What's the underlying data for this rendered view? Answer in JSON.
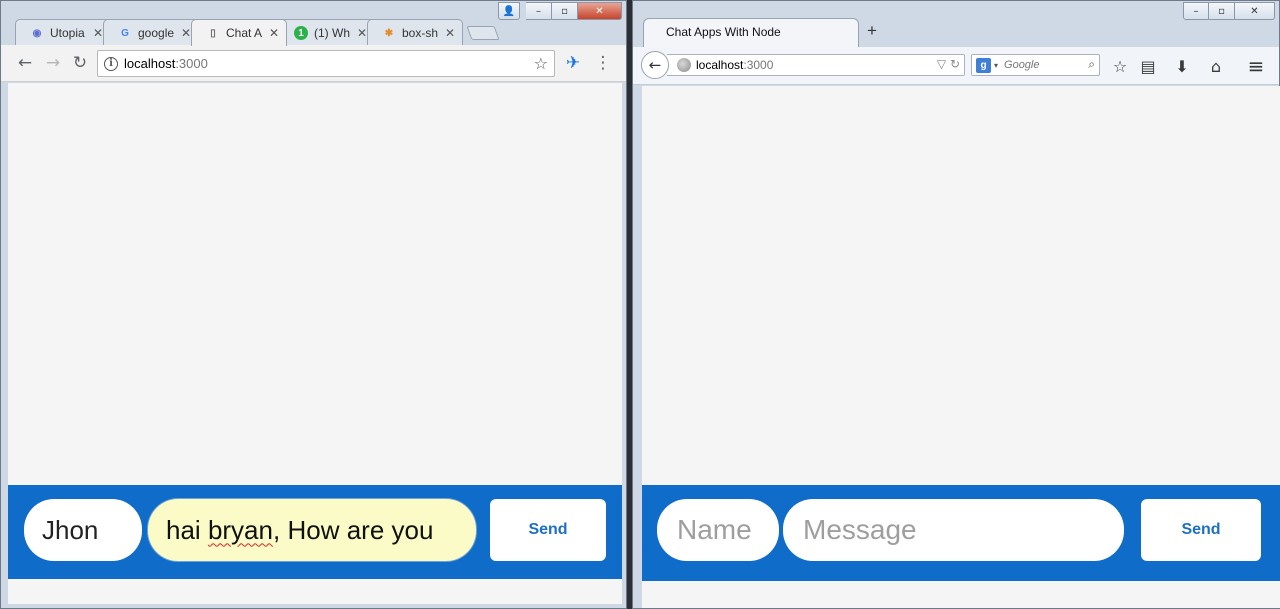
{
  "chrome": {
    "window_controls": {
      "user": "👤",
      "minimize": "–",
      "maximize": "▫",
      "close": "✕"
    },
    "tabs": [
      {
        "label": "Utopia",
        "favicon": "utopia-icon",
        "active": false
      },
      {
        "label": "google",
        "favicon": "google-icon",
        "active": false
      },
      {
        "label": "Chat A",
        "favicon": "page-icon",
        "active": true
      },
      {
        "label": "(1) Wh",
        "favicon": "notification-icon",
        "active": false
      },
      {
        "label": "box-sh",
        "favicon": "asterisk-icon",
        "active": false
      }
    ],
    "tab_close": "✕",
    "favicons": {
      "google": "G",
      "notification": "1",
      "asterisk": "✱",
      "page": "▯",
      "utopia": "◉"
    },
    "toolbar": {
      "back": "←",
      "forward": "→",
      "reload": "↻",
      "menu": "⋮",
      "extension": "✈"
    },
    "url": {
      "host": "localhost",
      "port": ":3000",
      "info": "i",
      "bookmark": "☆"
    },
    "chat": {
      "name_value": "Jhon",
      "message_value_words": [
        "hai",
        "bryan",
        ",",
        "How",
        "are",
        "you"
      ],
      "send_label": "Send"
    }
  },
  "firefox": {
    "window_controls": {
      "minimize": "–",
      "maximize": "▫",
      "close": "✕"
    },
    "tab_title": "Chat Apps With Node",
    "new_tab": "+",
    "toolbar": {
      "back": "←",
      "bookmark": "☆",
      "reading_list": "▤",
      "download": "⬇",
      "home": "⌂",
      "menu": "≡"
    },
    "url": {
      "host": "localhost",
      "port": ":3000",
      "dropdown": "▽",
      "reload": "↻"
    },
    "search": {
      "engine_badge": "g",
      "caret": "▾",
      "placeholder": "Google",
      "icon": "⌕"
    },
    "chat": {
      "name_placeholder": "Name",
      "message_placeholder": "Message",
      "send_label": "Send"
    }
  },
  "colors": {
    "chat_bar": "#0f6cc9",
    "send_text": "#1c6fc4",
    "content_bg": "#f5f5f5",
    "autofill_bg": "#fbfbc8"
  }
}
